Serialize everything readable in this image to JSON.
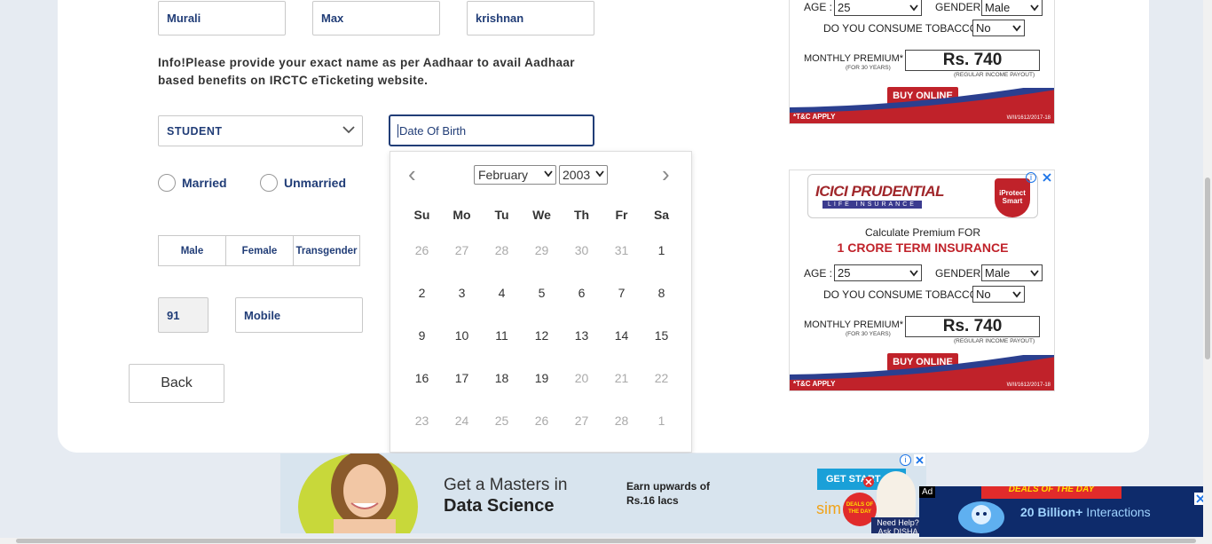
{
  "form": {
    "first_name": "Murali",
    "middle_name": "Max",
    "last_name": "krishnan",
    "info_text": "Info!Please provide your exact name as per Aadhaar to avail Aadhaar based benefits on IRCTC eTicketing website.",
    "occupation": "STUDENT",
    "dob_placeholder": "Date Of Birth",
    "marital": [
      "Married",
      "Unmarried"
    ],
    "gender": [
      "Male",
      "Female",
      "Transgender"
    ],
    "country_code": "91",
    "mobile_placeholder": "Mobile",
    "back_label": "Back"
  },
  "calendar": {
    "month": "February",
    "year": "2003",
    "prev": "‹",
    "next": "›",
    "weekdays": [
      "Su",
      "Mo",
      "Tu",
      "We",
      "Th",
      "Fr",
      "Sa"
    ],
    "weeks": [
      [
        {
          "d": "26",
          "o": true
        },
        {
          "d": "27",
          "o": true
        },
        {
          "d": "28",
          "o": true
        },
        {
          "d": "29",
          "o": true
        },
        {
          "d": "30",
          "o": true
        },
        {
          "d": "31",
          "o": true
        },
        {
          "d": "1",
          "o": false
        }
      ],
      [
        {
          "d": "2",
          "o": false
        },
        {
          "d": "3",
          "o": false
        },
        {
          "d": "4",
          "o": false
        },
        {
          "d": "5",
          "o": false
        },
        {
          "d": "6",
          "o": false
        },
        {
          "d": "7",
          "o": false
        },
        {
          "d": "8",
          "o": false
        }
      ],
      [
        {
          "d": "9",
          "o": false
        },
        {
          "d": "10",
          "o": false
        },
        {
          "d": "11",
          "o": false
        },
        {
          "d": "12",
          "o": false
        },
        {
          "d": "13",
          "o": false
        },
        {
          "d": "14",
          "o": false
        },
        {
          "d": "15",
          "o": false
        }
      ],
      [
        {
          "d": "16",
          "o": false
        },
        {
          "d": "17",
          "o": false
        },
        {
          "d": "18",
          "o": false
        },
        {
          "d": "19",
          "o": false
        },
        {
          "d": "20",
          "o": true
        },
        {
          "d": "21",
          "o": true
        },
        {
          "d": "22",
          "o": true
        }
      ],
      [
        {
          "d": "23",
          "o": true
        },
        {
          "d": "24",
          "o": true
        },
        {
          "d": "25",
          "o": true
        },
        {
          "d": "26",
          "o": true
        },
        {
          "d": "27",
          "o": true
        },
        {
          "d": "28",
          "o": true
        },
        {
          "d": "1",
          "o": true
        }
      ]
    ]
  },
  "ads": {
    "icici": {
      "logo": "ICICI PRUDENTIAL",
      "logo_sub": "LIFE INSURANCE",
      "badge": "iProtect Smart",
      "calc": "Calculate Premium FOR",
      "crore": "1 CRORE TERM INSURANCE",
      "age_label": "AGE :",
      "age_value": "25",
      "gender_label": "GENDER :",
      "gender_value": "Male",
      "tobacco_label": "DO YOU CONSUME TOBACCO ?",
      "tobacco_value": "No",
      "premium_label": "MONTHLY PREMIUM*",
      "premium_sub": "(FOR 30 YEARS)",
      "premium_value": "Rs. 740",
      "payout_note": "(REGULAR INCOME PAYOUT)",
      "buy_label": "BUY ONLINE",
      "tc": "*T&C APPLY",
      "ref": "W/II/1612/2017-18"
    },
    "banner": {
      "headline_1": "Get a Masters in",
      "headline_2": "Data Science",
      "earn_1": "Earn upwards of",
      "earn_2": "Rs.16 lacs",
      "cta": "GET START",
      "brand": "sim",
      "disha": "Need Help? Ask DISHA",
      "deals": "DEALS OF THE DAY"
    },
    "corner": {
      "ad_tag": "Ad",
      "deals": "DEALS OF THE DAY",
      "interactions_bold": "20 Billion+",
      "interactions": " Interactions"
    }
  },
  "colors": {
    "accent": "#213d77",
    "ad_red": "#c0222a",
    "page_bg": "#e6ebf2"
  }
}
